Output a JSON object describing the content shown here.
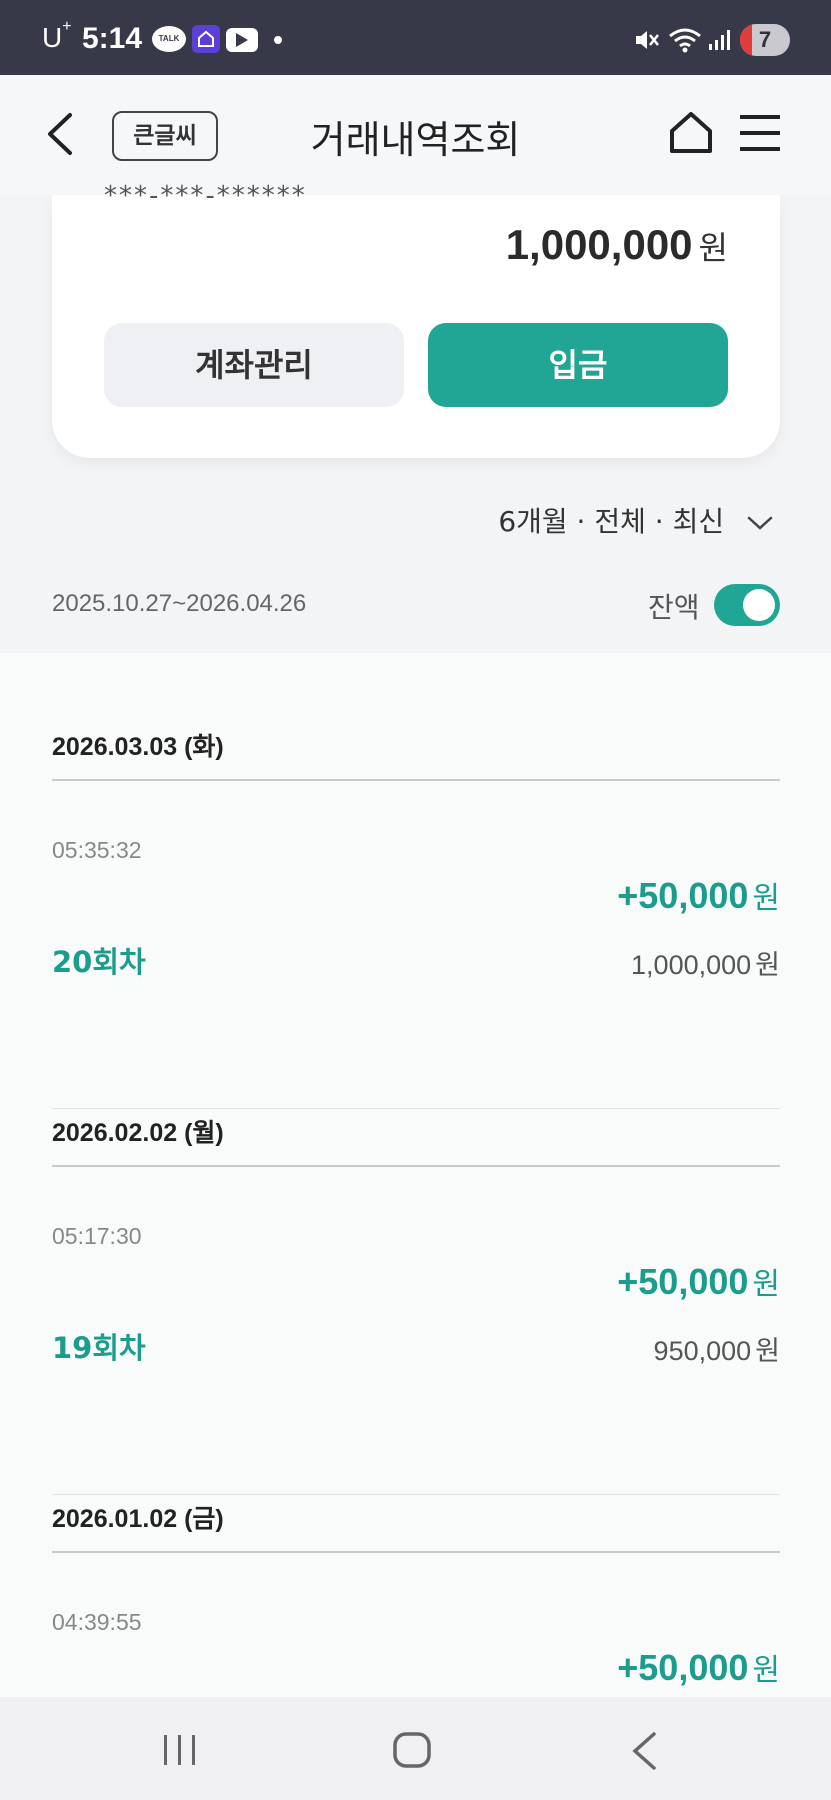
{
  "status_bar": {
    "carrier": "U",
    "carrier_sup": "+",
    "time": "5:14",
    "talk_label": "TALK",
    "battery": "7"
  },
  "header": {
    "font_size_badge": "큰글씨",
    "title": "거래내역조회"
  },
  "account": {
    "number_partial": "***-***-******",
    "balance": "1,000,000",
    "balance_unit": "원",
    "manage_button": "계좌관리",
    "deposit_button": "입금"
  },
  "filter": {
    "label": "6개월 · 전체 · 최신",
    "date_range": "2025.10.27~2026.04.26",
    "balance_toggle_label": "잔액",
    "balance_toggle_on": true
  },
  "transactions": [
    {
      "date": "2026.03.03 (화)",
      "time": "05:35:32",
      "amount": "+50,000",
      "unit": "원",
      "round": "20회차",
      "balance": "1,000,000",
      "balance_unit": "원"
    },
    {
      "date": "2026.02.02 (월)",
      "time": "05:17:30",
      "amount": "+50,000",
      "unit": "원",
      "round": "19회차",
      "balance": "950,000",
      "balance_unit": "원"
    },
    {
      "date": "2026.01.02 (금)",
      "time": "04:39:55",
      "amount": "+50,000",
      "unit": "원",
      "round": "",
      "balance": "",
      "balance_unit": ""
    }
  ],
  "colors": {
    "accent": "#21a594",
    "status_bar": "#373949"
  }
}
